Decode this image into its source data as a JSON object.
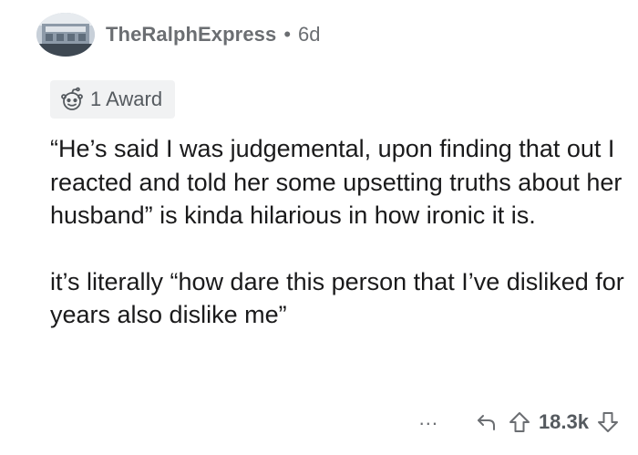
{
  "comment": {
    "username": "TheRalphExpress",
    "separator": "•",
    "age": "6d",
    "award_label": "1 Award",
    "paragraphs": [
      "“He’s said I was judgemental, upon finding that out I reacted and told her some upsetting truths about her husband” is kinda hilarious in how ironic it is.",
      "it’s literally “how dare this person that I’ve disliked for years also dislike me”"
    ],
    "more_label": "...",
    "score": "18.3k"
  },
  "icons": {
    "award": "award-icon",
    "reply": "reply-icon",
    "upvote": "upvote-icon",
    "downvote": "downvote-icon"
  },
  "colors": {
    "meta_text": "#6b6e72",
    "body_text": "#1a1a1b",
    "award_bg": "#f1f2f3"
  }
}
